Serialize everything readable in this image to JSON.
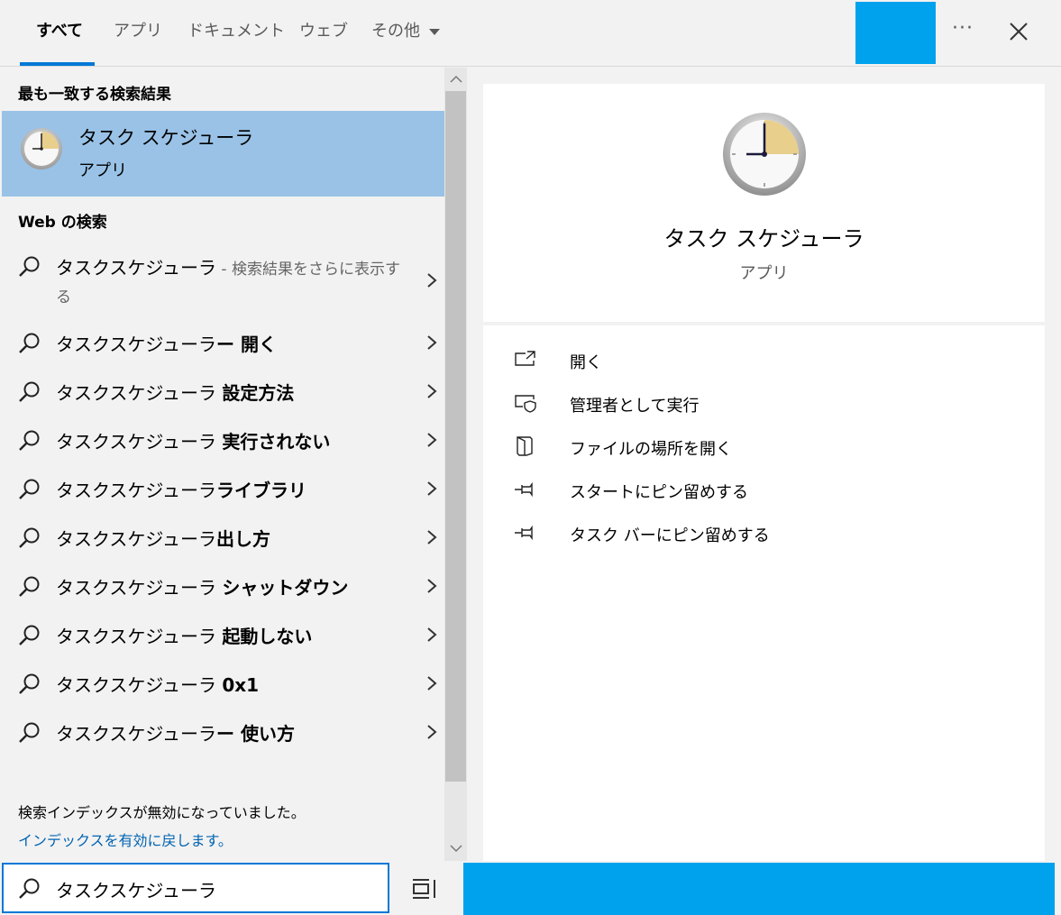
{
  "tabs": [
    {
      "label": "すべて",
      "active": true
    },
    {
      "label": "アプリ"
    },
    {
      "label": "ドキュメント"
    },
    {
      "label": "ウェブ"
    },
    {
      "label": "その他"
    }
  ],
  "header": {
    "more_label": "···",
    "accent_color": "#00a2ed"
  },
  "best_match": {
    "section_label": "最も一致する検索結果",
    "title": "タスク スケジューラ",
    "subtitle": "アプリ",
    "icon": "clock-icon"
  },
  "web": {
    "section_label": "Web の検索",
    "first": {
      "query": "タスクスケジューラ",
      "hint_line1": " - 検索結果をさらに表示す",
      "hint_line2": "る"
    },
    "suggestions": [
      {
        "base": "タスクスケジューラ",
        "bold": "ー 開く"
      },
      {
        "base": "タスクスケジューラ ",
        "bold": "設定方法"
      },
      {
        "base": "タスクスケジューラ ",
        "bold": "実行されない"
      },
      {
        "base": "タスクスケジューラ",
        "bold": "ライブラリ"
      },
      {
        "base": "タスクスケジューラ",
        "bold": "出し方"
      },
      {
        "base": "タスクスケジューラ ",
        "bold": "シャットダウン"
      },
      {
        "base": "タスクスケジューラ ",
        "bold": "起動しない"
      },
      {
        "base": "タスクスケジューラ ",
        "bold": "0x1"
      },
      {
        "base": "タスクスケジューラ",
        "bold": "ー 使い方"
      }
    ]
  },
  "index_notice": {
    "message": "検索インデックスが無効になっていました。",
    "link": "インデックスを有効に戻します。"
  },
  "detail": {
    "title": "タスク スケジューラ",
    "subtitle": "アプリ",
    "actions": [
      {
        "label": "開く",
        "icon": "open-icon"
      },
      {
        "label": "管理者として実行",
        "icon": "shield-icon"
      },
      {
        "label": "ファイルの場所を開く",
        "icon": "file-location-icon"
      },
      {
        "label": "スタートにピン留めする",
        "icon": "pin-icon"
      },
      {
        "label": "タスク バーにピン留めする",
        "icon": "pin-icon"
      }
    ]
  },
  "search": {
    "value": "タスクスケジューラ"
  }
}
